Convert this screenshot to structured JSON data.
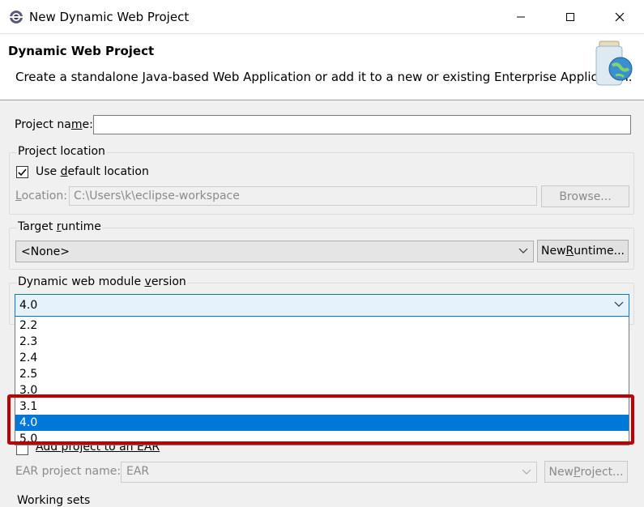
{
  "window": {
    "title": "New Dynamic Web Project",
    "minimize_icon": "minimize-icon",
    "maximize_icon": "maximize-icon",
    "close_icon": "close-icon"
  },
  "header": {
    "title": "Dynamic Web Project",
    "description": "Create a standalone Java-based Web Application or add it to a new or existing Enterprise Application."
  },
  "project_name": {
    "label_pre": "Project na",
    "label_mnemonic": "m",
    "label_post": "e:",
    "value": ""
  },
  "project_location": {
    "group_label": "Project location",
    "use_default_pre": "Use ",
    "use_default_mnemonic": "d",
    "use_default_post": "efault location",
    "use_default_checked": true,
    "location_label_mnemonic": "L",
    "location_label_post": "ocation:",
    "location_value": "C:\\Users\\k\\eclipse-workspace",
    "browse_label": "Browse..."
  },
  "target_runtime": {
    "group_label_pre": "Target ",
    "group_label_mnemonic": "r",
    "group_label_post": "untime",
    "selected": "<None>",
    "new_runtime_pre": "New ",
    "new_runtime_mnemonic": "R",
    "new_runtime_post": "untime..."
  },
  "module_version": {
    "group_label_pre": "Dynamic web module ",
    "group_label_mnemonic": "v",
    "group_label_post": "ersion",
    "selected": "4.0",
    "options": [
      "2.2",
      "2.3",
      "2.4",
      "2.5",
      "3.0",
      "3.1",
      "4.0",
      "5.0"
    ],
    "selected_index": 6
  },
  "ear": {
    "add_to_ear_label": "Add project to an EAR",
    "ear_name_label": "EAR project name:",
    "ear_name_value": "EAR",
    "new_project_pre": "New ",
    "new_project_mnemonic": "P",
    "new_project_post": "roject..."
  },
  "working_sets": {
    "label": "Working sets"
  },
  "colors": {
    "selection": "#0078d7",
    "highlight_box": "#c00000"
  }
}
